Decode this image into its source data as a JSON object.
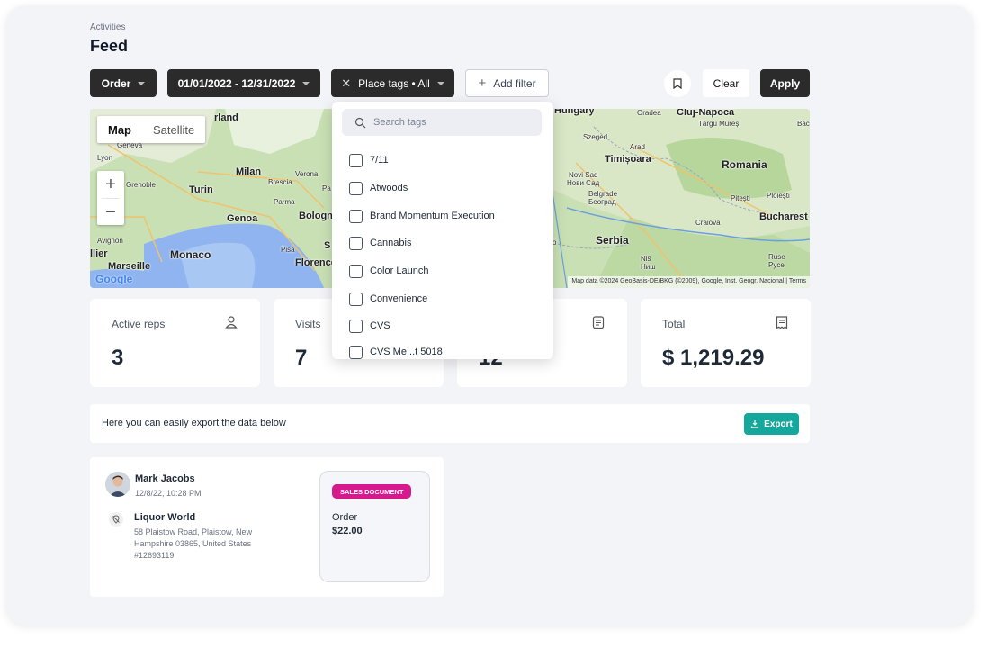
{
  "header": {
    "breadcrumb": "Activities",
    "title": "Feed"
  },
  "filters": {
    "order_label": "Order",
    "date_range": "01/01/2022 - 12/31/2022",
    "place_tags_label": "Place tags • All",
    "add_filter_label": "Add filter",
    "clear_label": "Clear",
    "apply_label": "Apply"
  },
  "map": {
    "type_map": "Map",
    "type_satellite": "Satellite",
    "attribution": "Map data ©2024 GeoBasis-DE/BKG (©2009), Google, Inst. Geogr. Nacional | Terms",
    "google_logo": "Google",
    "labels": {
      "rland": "rland",
      "geneva": "Geneva",
      "lyon": "Lyon",
      "grenoble": "Grenoble",
      "turin": "Turin",
      "milan": "Milan",
      "verona": "Verona",
      "brescia": "Brescia",
      "parma": "Parma",
      "genoa": "Genoa",
      "bologna": "Bologn",
      "avignon": "Avignon",
      "ilier": "llier",
      "monaco": "Monaco",
      "marseille": "Marseille",
      "pisa": "Pisa",
      "florence": "Florence",
      "s": "S",
      "pa": "Pa",
      "hungary": "Hungary",
      "oradea": "Oradea",
      "cluj": "Cluj-Napoca",
      "targu": "Târgu Mureș",
      "bac": "Bac",
      "szeged": "Szeged",
      "arad": "Arad",
      "timisoara": "Timișoara",
      "romania": "Romania",
      "novisad": "Novi Sad",
      "novisad_cyr": "Нови Сад",
      "belgrade": "Belgrade",
      "belgrade_cyr": "Београд",
      "pitesti": "Pitești",
      "ploiesti": "Ploiești",
      "craiova": "Craiova",
      "bucharest": "Bucharest",
      "serbia": "Serbia",
      "nis": "Niš",
      "nis_cyr": "Ниш",
      "ruse": "Ruse",
      "ruse_cyr": "Pyce",
      "o": "o"
    }
  },
  "stats": [
    {
      "label": "Active reps",
      "value": "3",
      "icon": "user-icon"
    },
    {
      "label": "Visits",
      "value": "7",
      "icon": ""
    },
    {
      "label": "",
      "value": "12",
      "icon": "clipboard-icon"
    },
    {
      "label": "Total",
      "value": "$ 1,219.29",
      "icon": "receipt-icon"
    }
  ],
  "export": {
    "text": "Here you can easily export the data below",
    "button_label": "Export"
  },
  "feed_item": {
    "user_name": "Mark Jacobs",
    "timestamp": "12/8/22, 10:28 PM",
    "place_name": "Liquor World",
    "address": "58 Plaistow Road, Plaistow, New Hampshire 03865, United States",
    "reference": "#12693119",
    "doc_badge": "SALES DOCUMENT",
    "doc_type": "Order",
    "doc_amount": "$22.00"
  },
  "tag_dropdown": {
    "search_placeholder": "Search tags",
    "options": [
      "7/11",
      "Atwoods",
      "Brand Momentum Execution",
      "Cannabis",
      "Color Launch",
      "Convenience",
      "CVS",
      "CVS Me...t 5018"
    ]
  },
  "colors": {
    "dark": "#2b2b2b",
    "accent": "#14a89d",
    "badge": "#d6198d"
  }
}
